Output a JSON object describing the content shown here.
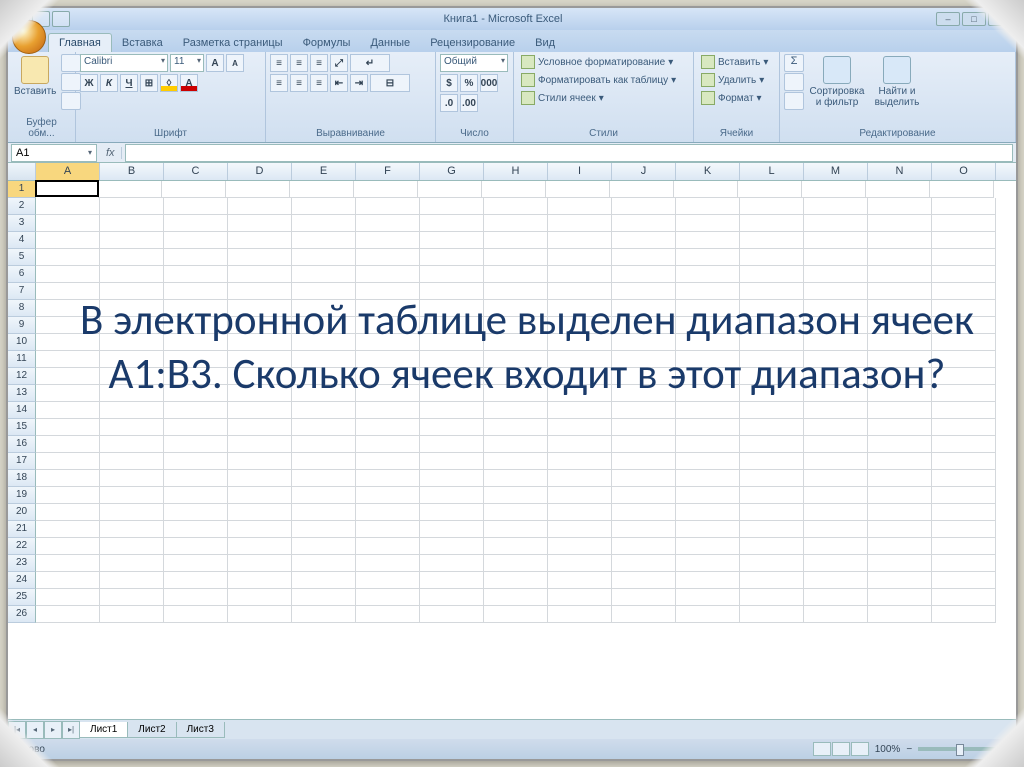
{
  "title": "Книга1 - Microsoft Excel",
  "tabs": {
    "home": "Главная",
    "insert": "Вставка",
    "layout": "Разметка страницы",
    "formulas": "Формулы",
    "data": "Данные",
    "review": "Рецензирование",
    "view": "Вид"
  },
  "ribbon": {
    "clipboard": {
      "paste": "Вставить",
      "label": "Буфер обм..."
    },
    "font": {
      "name": "Calibri",
      "size": "11",
      "label": "Шрифт"
    },
    "align": {
      "label": "Выравнивание"
    },
    "number": {
      "format": "Общий",
      "label": "Число"
    },
    "styles": {
      "cond": "Условное форматирование",
      "table": "Форматировать как таблицу",
      "cell": "Стили ячеек",
      "label": "Стили"
    },
    "cells": {
      "insert": "Вставить",
      "delete": "Удалить",
      "format": "Формат",
      "label": "Ячейки"
    },
    "editing": {
      "sort": "Сортировка и фильтр",
      "find": "Найти и выделить",
      "label": "Редактирование"
    }
  },
  "namebox": "A1",
  "fx": "fx",
  "columns": [
    "A",
    "B",
    "C",
    "D",
    "E",
    "F",
    "G",
    "H",
    "I",
    "J",
    "K",
    "L",
    "M",
    "N",
    "O"
  ],
  "rows_count": 26,
  "overlay_text": "В электронной таблице выделен диапазон ячеек A1:B3. Сколько ячеек входит в этот диапазон?",
  "sheets": {
    "s1": "Лист1",
    "s2": "Лист2",
    "s3": "Лист3"
  },
  "status": {
    "ready": "Готово",
    "zoom": "100%"
  }
}
